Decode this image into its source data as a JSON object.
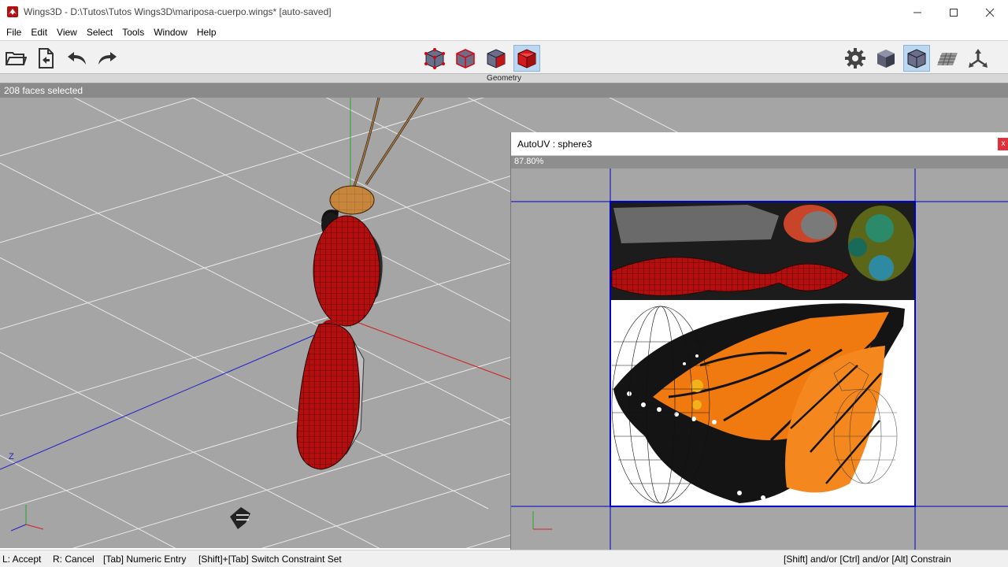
{
  "window": {
    "title": "Wings3D - D:\\Tutos\\Tutos Wings3D\\mariposa-cuerpo.wings* [auto-saved]",
    "app_icon": "wings3d-icon",
    "controls": [
      "minimize-icon",
      "maximize-icon",
      "close-icon"
    ]
  },
  "menu": [
    "File",
    "Edit",
    "View",
    "Select",
    "Tools",
    "Window",
    "Help"
  ],
  "toolbar": {
    "left_buttons": [
      "open-folder-icon",
      "save-file-icon",
      "undo-icon",
      "redo-icon"
    ],
    "selection_modes": [
      "vertex-mode-icon",
      "edge-mode-icon",
      "face-mode-icon",
      "body-mode-icon"
    ],
    "active_selection_mode": "body-mode-icon",
    "right_buttons": [
      "settings-gear-icon",
      "smooth-shading-icon",
      "wireframe-shading-icon",
      "ground-grid-icon",
      "axes-orientation-icon"
    ],
    "active_right_button": "wireframe-shading-icon"
  },
  "geometry_header": "Geometry",
  "viewport": {
    "info": "208 faces selected",
    "axis_label_z": "Z",
    "colors": {
      "background": "#a5a5a5",
      "selection": "#b30f0f",
      "x_axis": "#d22020",
      "y_axis": "#2aa42a",
      "z_axis": "#2020c8"
    }
  },
  "autouv": {
    "title": "AutoUV : sphere3",
    "zoom": "87.80%",
    "close_label": "x",
    "colors": {
      "background": "#a6a6a6",
      "frame": "#0000c8",
      "wing_orange": "#f07a10",
      "body_red": "#a81313"
    }
  },
  "statusbar": {
    "accept": "L: Accept",
    "cancel": "R: Cancel",
    "numeric": "[Tab] Numeric Entry",
    "switch": "[Shift]+[Tab] Switch Constraint Set",
    "constrain": "[Shift] and/or [Ctrl] and/or [Alt] Constrain"
  }
}
